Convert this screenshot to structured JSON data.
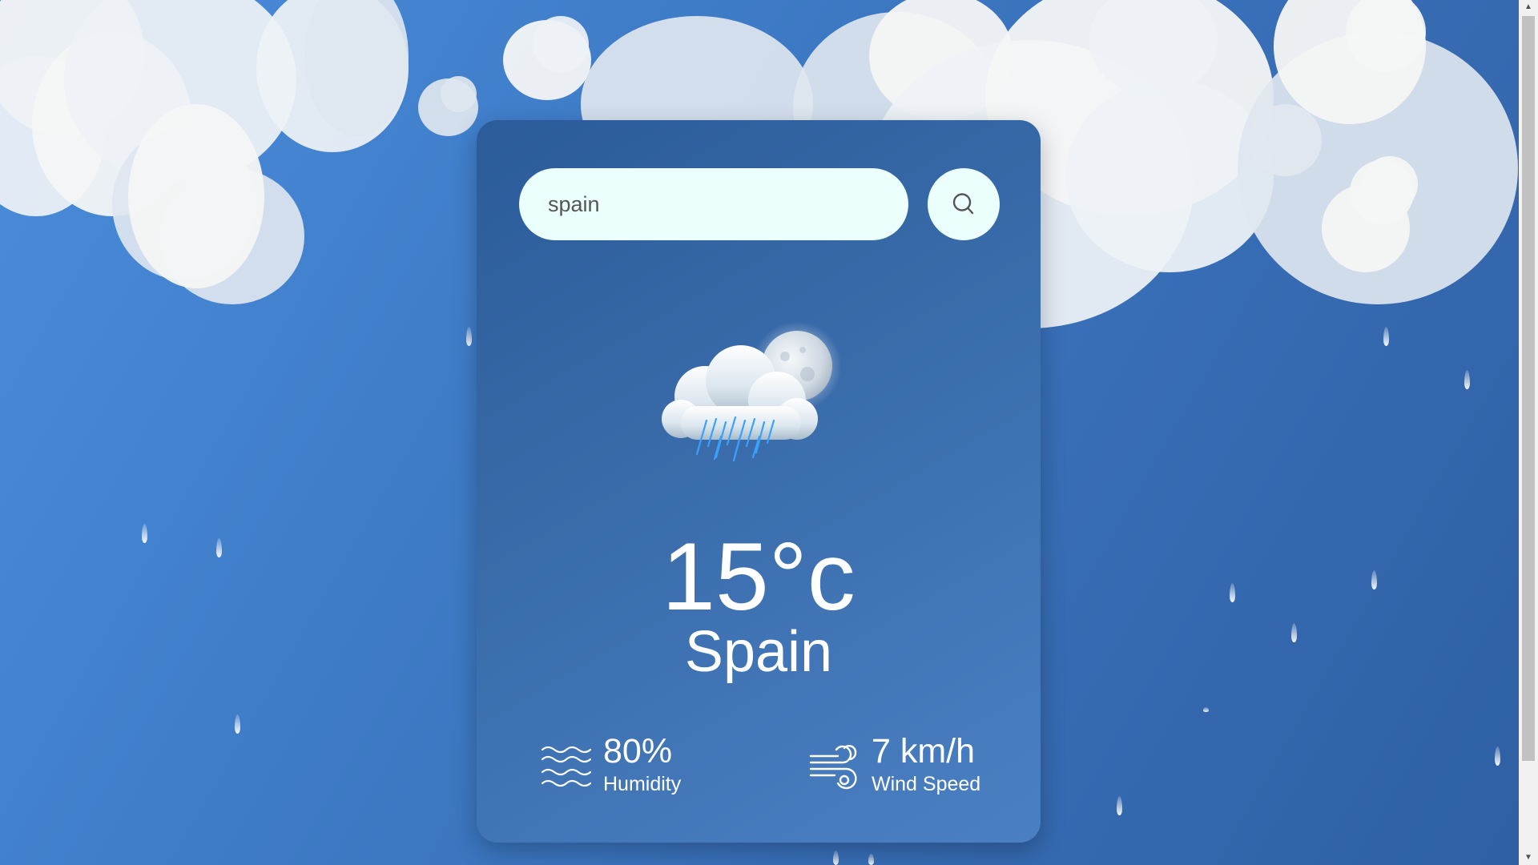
{
  "search": {
    "value": "spain",
    "button_icon": "search-icon"
  },
  "weather": {
    "icon": "rain-cloud-moon-icon",
    "temperature": "15°c",
    "city": "Spain"
  },
  "stats": {
    "humidity": {
      "icon": "humidity-waves-icon",
      "value": "80%",
      "label": "Humidity"
    },
    "wind": {
      "icon": "wind-icon",
      "value": "7 km/h",
      "label": "Wind Speed"
    }
  },
  "colors": {
    "background": "#3d79c4",
    "card": "#3a6cab",
    "input": "#ebfffc",
    "text": "#ffffff"
  }
}
